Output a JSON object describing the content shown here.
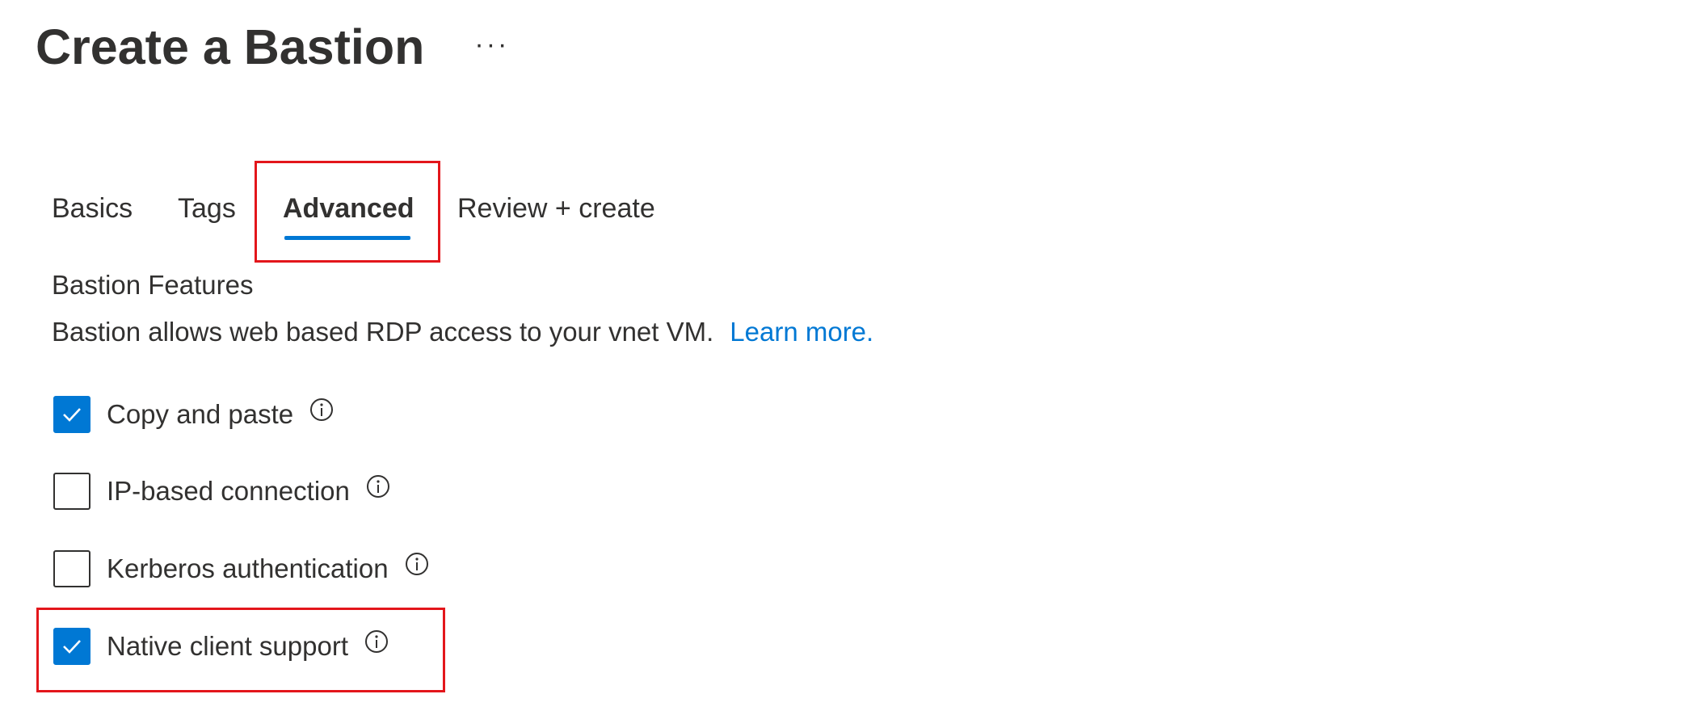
{
  "header": {
    "title": "Create a Bastion",
    "more_label": "···"
  },
  "tabs": [
    {
      "label": "Basics",
      "active": false
    },
    {
      "label": "Tags",
      "active": false
    },
    {
      "label": "Advanced",
      "active": true
    },
    {
      "label": "Review + create",
      "active": false
    }
  ],
  "section": {
    "title": "Bastion Features",
    "description": "Bastion allows web based RDP access to your vnet VM.",
    "link_label": "Learn more."
  },
  "features": [
    {
      "label": "Copy and paste",
      "checked": true,
      "icon": "info-icon"
    },
    {
      "label": "IP-based connection",
      "checked": false,
      "icon": "info-icon"
    },
    {
      "label": "Kerberos authentication",
      "checked": false,
      "icon": "info-icon"
    },
    {
      "label": "Native client support",
      "checked": true,
      "icon": "info-icon"
    }
  ],
  "colors": {
    "accent": "#0078d4",
    "highlight": "#e3161b",
    "text": "#323130"
  }
}
